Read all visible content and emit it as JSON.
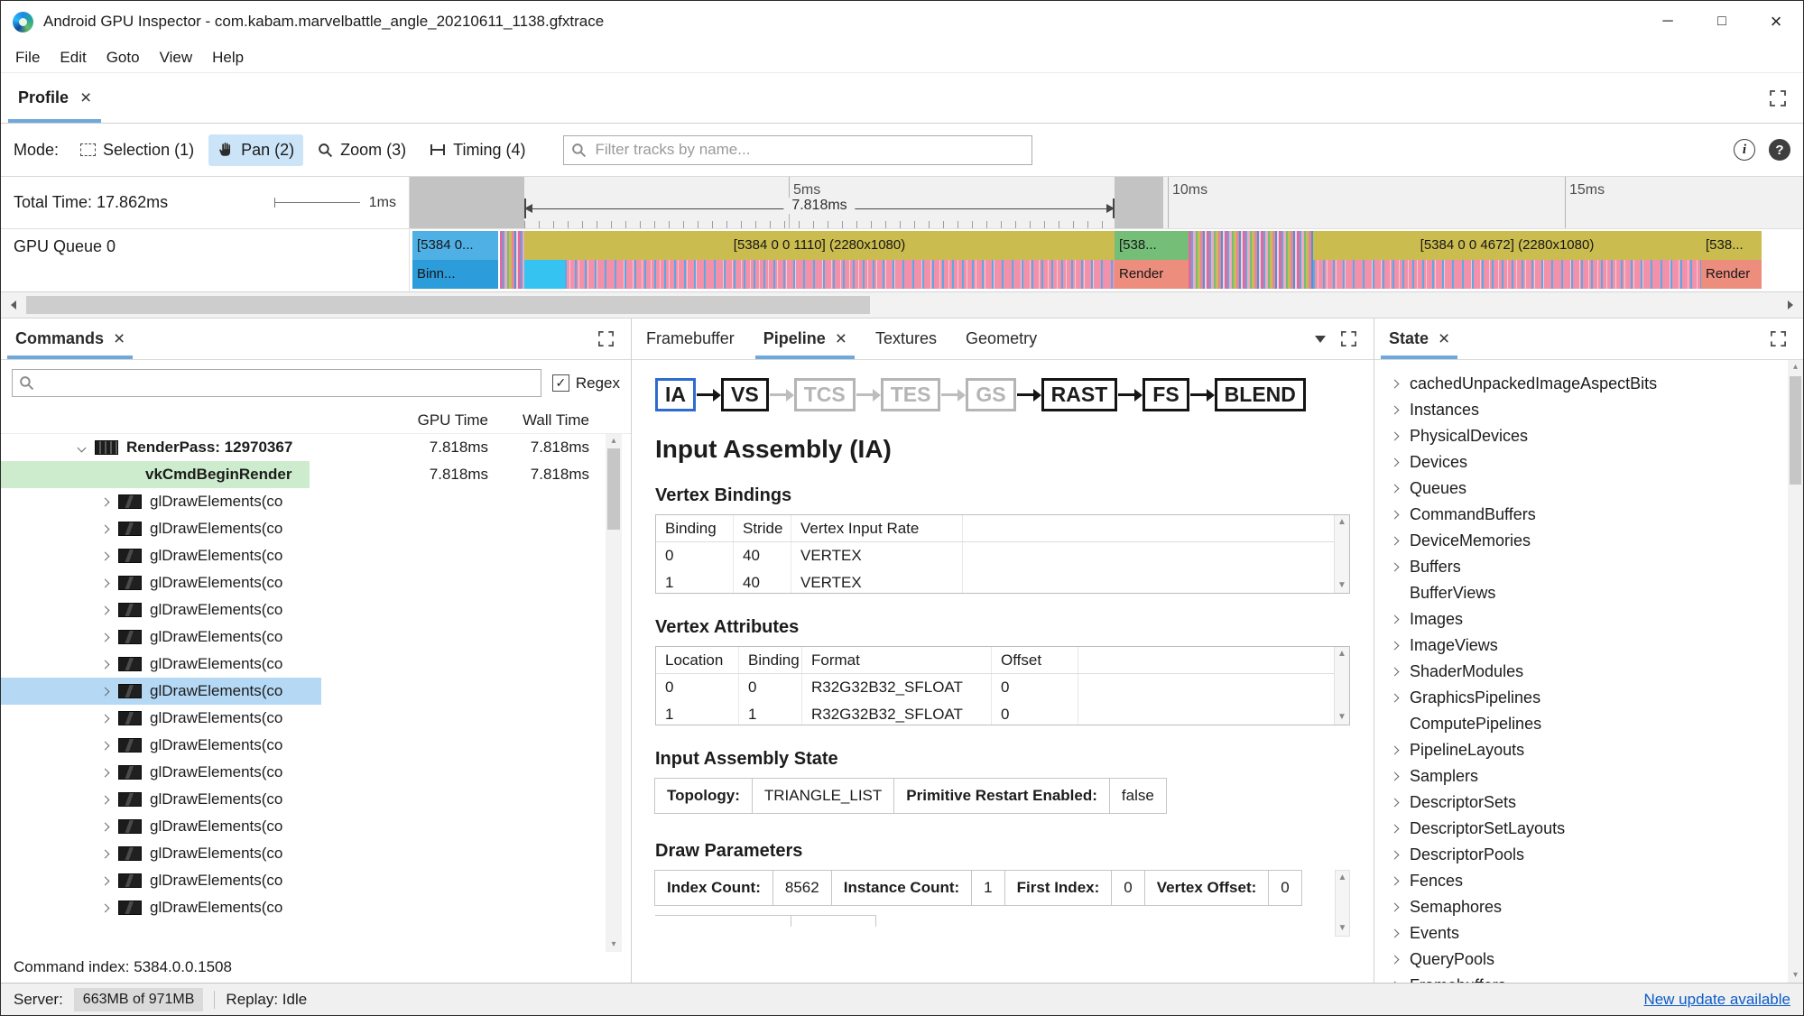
{
  "window": {
    "title": "Android GPU Inspector - com.kabam.marvelbattle_angle_20210611_1138.gfxtrace",
    "minimize": "─",
    "maximize": "□",
    "close": "×"
  },
  "colors": {
    "tab_accent": "#6FA8DC",
    "row_selected_green": "#CDECCD",
    "row_selected_blue": "#B5D8F5",
    "link_blue": "#0B5CC9"
  },
  "menu": {
    "items": [
      "File",
      "Edit",
      "Goto",
      "View",
      "Help"
    ]
  },
  "tabs": {
    "profile": "Profile"
  },
  "toolbar": {
    "mode_label": "Mode:",
    "modes": [
      {
        "label": "Selection (1)",
        "active": false
      },
      {
        "label": "Pan (2)",
        "active": true
      },
      {
        "label": "Zoom (3)",
        "active": false
      },
      {
        "label": "Timing (4)",
        "active": false
      }
    ],
    "filter_placeholder": "Filter tracks by name..."
  },
  "timeline": {
    "total_time_label": "Total Time: 17.862ms",
    "scale_label": "1ms",
    "ruler_labels": [
      "5ms",
      "10ms",
      "15ms"
    ],
    "span_label": "7.818ms",
    "track_name": "GPU Queue 0",
    "blocks": [
      {
        "top": "[5384 0...",
        "bottom": "Binn...",
        "top_color": "#4FB0E6",
        "bottom_color": "#2D9CDB"
      },
      {
        "top": "[5384 0 0 1110] (2280x1080)",
        "top_color": "#CBBC4F"
      },
      {
        "top": "[538...",
        "bottom": "Render",
        "top_color": "#74BE78",
        "bottom_color": "#EC8D7E"
      },
      {
        "top": "[5384 0 0 4672] (2280x1080)",
        "top_color": "#CBBC4F"
      },
      {
        "top": "[538...",
        "bottom": "Render",
        "top_color": "#CBBC4F",
        "bottom_color": "#EC8D7E"
      }
    ]
  },
  "commands": {
    "tab": "Commands",
    "regex_label": "Regex",
    "checkbox_check": "✓",
    "columns": [
      "GPU Time",
      "Wall Time"
    ],
    "rows": [
      {
        "kind": "renderpass",
        "label": "RenderPass: 12970367",
        "gpu": "7.818ms",
        "wall": "7.818ms"
      },
      {
        "kind": "begin",
        "label": "vkCmdBeginRender",
        "gpu": "7.818ms",
        "wall": "7.818ms",
        "highlight": "green"
      },
      {
        "kind": "draw",
        "label": "glDrawElements(co"
      },
      {
        "kind": "draw",
        "label": "glDrawElements(co"
      },
      {
        "kind": "draw",
        "label": "glDrawElements(co"
      },
      {
        "kind": "draw",
        "label": "glDrawElements(co"
      },
      {
        "kind": "draw",
        "label": "glDrawElements(co"
      },
      {
        "kind": "draw",
        "label": "glDrawElements(co"
      },
      {
        "kind": "draw",
        "label": "glDrawElements(co"
      },
      {
        "kind": "draw",
        "label": "glDrawElements(co",
        "highlight": "blue"
      },
      {
        "kind": "draw",
        "label": "glDrawElements(co"
      },
      {
        "kind": "draw",
        "label": "glDrawElements(co"
      },
      {
        "kind": "draw",
        "label": "glDrawElements(co"
      },
      {
        "kind": "draw",
        "label": "glDrawElements(co"
      },
      {
        "kind": "draw",
        "label": "glDrawElements(co"
      },
      {
        "kind": "draw",
        "label": "glDrawElements(co"
      },
      {
        "kind": "draw",
        "label": "glDrawElements(co"
      },
      {
        "kind": "draw",
        "label": "glDrawElements(co"
      }
    ],
    "footer": "Command index: 5384.0.0.1508"
  },
  "pipeline_panel": {
    "tabs": [
      "Framebuffer",
      "Pipeline",
      "Textures",
      "Geometry"
    ],
    "active_tab": "Pipeline",
    "stages": [
      {
        "label": "IA",
        "state": "selected"
      },
      {
        "label": "VS",
        "state": "normal"
      },
      {
        "label": "TCS",
        "state": "disabled"
      },
      {
        "label": "TES",
        "state": "disabled"
      },
      {
        "label": "GS",
        "state": "disabled"
      },
      {
        "label": "RAST",
        "state": "normal"
      },
      {
        "label": "FS",
        "state": "normal"
      },
      {
        "label": "BLEND",
        "state": "normal"
      }
    ],
    "heading": "Input Assembly (IA)",
    "vertex_bindings": {
      "title": "Vertex Bindings",
      "headers": [
        "Binding",
        "Stride",
        "Vertex Input Rate"
      ],
      "rows": [
        [
          "0",
          "40",
          "VERTEX"
        ],
        [
          "1",
          "40",
          "VERTEX"
        ]
      ]
    },
    "vertex_attributes": {
      "title": "Vertex Attributes",
      "headers": [
        "Location",
        "Binding",
        "Format",
        "Offset"
      ],
      "rows": [
        [
          "0",
          "0",
          "R32G32B32_SFLOAT",
          "0"
        ],
        [
          "1",
          "1",
          "R32G32B32_SFLOAT",
          "0"
        ]
      ]
    },
    "ia_state": {
      "title": "Input Assembly State",
      "pairs": [
        {
          "label": "Topology:",
          "value": "TRIANGLE_LIST"
        },
        {
          "label": "Primitive Restart Enabled:",
          "value": "false"
        }
      ]
    },
    "draw_params": {
      "title": "Draw Parameters",
      "pairs": [
        {
          "label": "Index Count:",
          "value": "8562"
        },
        {
          "label": "Instance Count:",
          "value": "1"
        },
        {
          "label": "First Index:",
          "value": "0"
        },
        {
          "label": "Vertex Offset:",
          "value": "0"
        }
      ]
    }
  },
  "state_panel": {
    "tab": "State",
    "items": [
      {
        "label": "cachedUnpackedImageAspectBits",
        "chevron": true
      },
      {
        "label": "Instances",
        "chevron": true
      },
      {
        "label": "PhysicalDevices",
        "chevron": true
      },
      {
        "label": "Devices",
        "chevron": true
      },
      {
        "label": "Queues",
        "chevron": true
      },
      {
        "label": "CommandBuffers",
        "chevron": true
      },
      {
        "label": "DeviceMemories",
        "chevron": true
      },
      {
        "label": "Buffers",
        "chevron": true
      },
      {
        "label": "BufferViews",
        "chevron": false
      },
      {
        "label": "Images",
        "chevron": true
      },
      {
        "label": "ImageViews",
        "chevron": true
      },
      {
        "label": "ShaderModules",
        "chevron": true
      },
      {
        "label": "GraphicsPipelines",
        "chevron": true
      },
      {
        "label": "ComputePipelines",
        "chevron": false
      },
      {
        "label": "PipelineLayouts",
        "chevron": true
      },
      {
        "label": "Samplers",
        "chevron": true
      },
      {
        "label": "DescriptorSets",
        "chevron": true
      },
      {
        "label": "DescriptorSetLayouts",
        "chevron": true
      },
      {
        "label": "DescriptorPools",
        "chevron": true
      },
      {
        "label": "Fences",
        "chevron": true
      },
      {
        "label": "Semaphores",
        "chevron": true
      },
      {
        "label": "Events",
        "chevron": true
      },
      {
        "label": "QueryPools",
        "chevron": true
      },
      {
        "label": "Framebuffers",
        "chevron": true
      }
    ]
  },
  "status": {
    "server_label": "Server:",
    "server_value": "663MB of 971MB",
    "replay": "Replay: Idle",
    "update_link": "New update available"
  }
}
